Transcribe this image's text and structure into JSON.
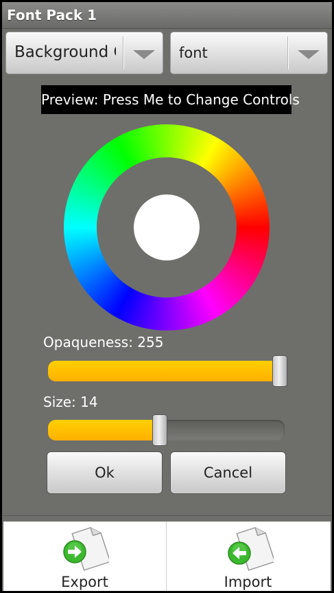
{
  "title": "Font Pack 1",
  "spinners": {
    "left_value": "Background Color",
    "right_value": "font"
  },
  "preview_label": "Preview: Press Me to Change Controls",
  "color_wheel": {
    "selected_color": "#ffffff"
  },
  "opaqueness": {
    "label": "Opaqueness:",
    "value": "255",
    "fraction": 1.0
  },
  "size": {
    "label": "Size:",
    "value": "14",
    "fraction": 0.47
  },
  "buttons": {
    "ok": "Ok",
    "cancel": "Cancel"
  },
  "bottom_tabs": {
    "export": "Export",
    "import": "Import"
  },
  "colors": {
    "accent": "#ffc000",
    "background": "#6e6f6b",
    "icon_green": "#3cb82e"
  },
  "icons": {
    "export": "document-arrow-right-icon",
    "import": "document-arrow-left-icon",
    "dropdown": "triangle-down-icon"
  }
}
